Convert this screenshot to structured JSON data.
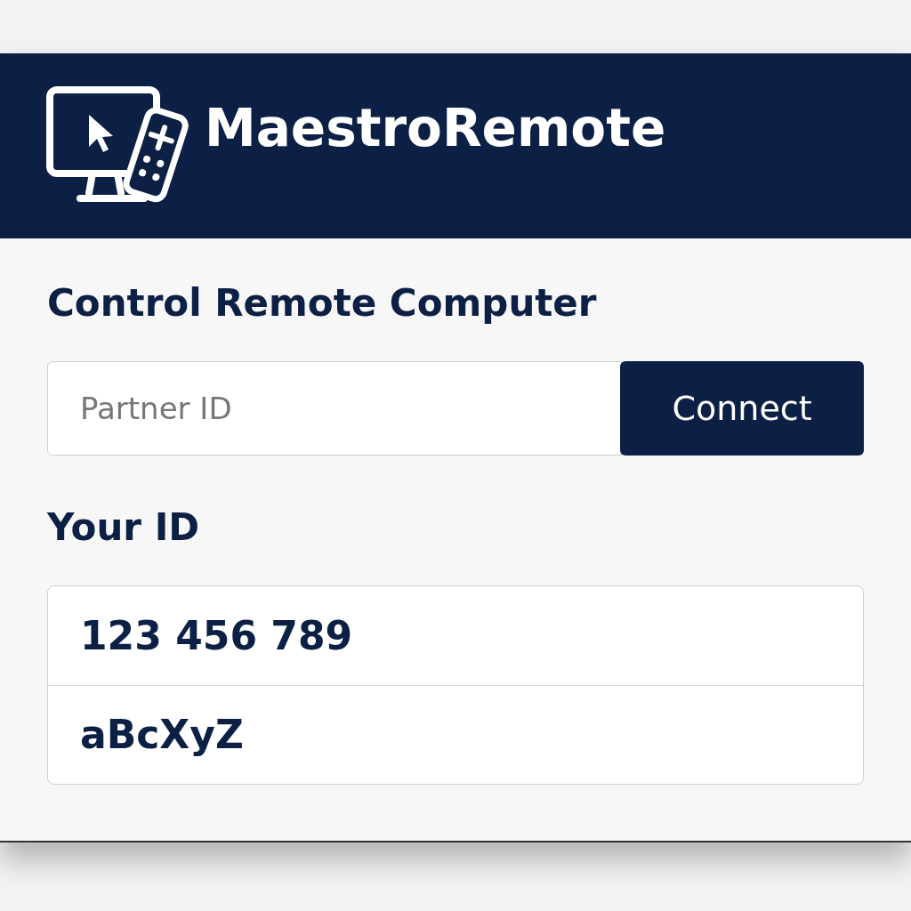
{
  "app": {
    "title": "MaestroRemote"
  },
  "control_section": {
    "heading": "Control Remote Computer",
    "partner_field": {
      "placeholder": "Partner ID"
    },
    "connect_button": "Connect"
  },
  "your_id_section": {
    "heading": "Your ID",
    "rows": [
      {
        "value": "123 456 789"
      },
      {
        "value": "aBcXyZ"
      }
    ]
  }
}
